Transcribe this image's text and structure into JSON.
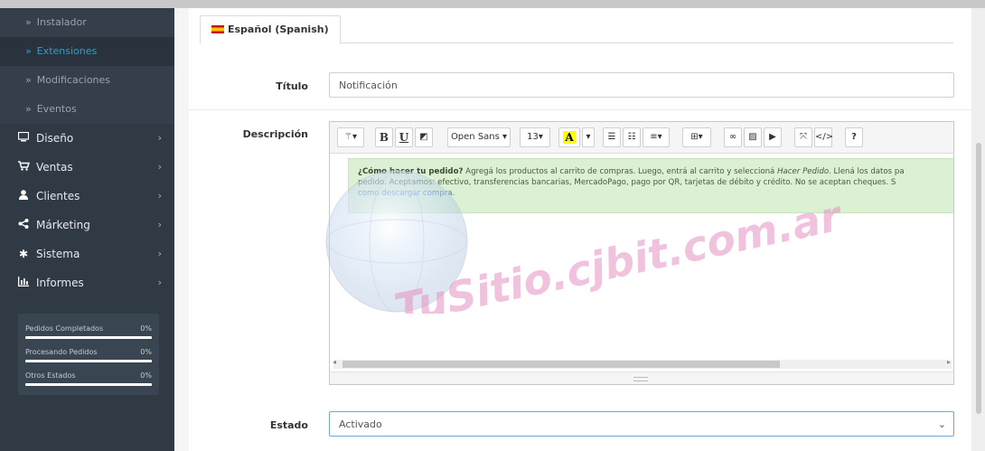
{
  "sidebar": {
    "subitems": [
      {
        "label": "Instalador",
        "active": false
      },
      {
        "label": "Extensiones",
        "active": true
      },
      {
        "label": "Modificaciones",
        "active": false
      },
      {
        "label": "Eventos",
        "active": false
      }
    ],
    "items": [
      {
        "label": "Diseño",
        "icon": "monitor-icon"
      },
      {
        "label": "Ventas",
        "icon": "cart-icon"
      },
      {
        "label": "Clientes",
        "icon": "user-icon"
      },
      {
        "label": "Márketing",
        "icon": "share-icon"
      },
      {
        "label": "Sistema",
        "icon": "gear-icon"
      },
      {
        "label": "Informes",
        "icon": "bar-chart-icon"
      }
    ],
    "stats": [
      {
        "label": "Pedidos Completados",
        "percent": "0%"
      },
      {
        "label": "Procesando Pedidos",
        "percent": "0%"
      },
      {
        "label": "Otros Estados",
        "percent": "0%"
      }
    ]
  },
  "form": {
    "language_tab": "Español (Spanish)",
    "title_label": "Título",
    "title_value": "Notificación",
    "description_label": "Descripción",
    "status_label": "Estado",
    "status_value": "Activado"
  },
  "editor": {
    "font_name": "Open Sans ▾",
    "font_size": "13▾",
    "toolbar_icons": [
      "magic-icon",
      "bold-icon",
      "underline-icon",
      "eraser-icon",
      "font-family-select",
      "font-size-select",
      "highlight-color-icon",
      "color-dropdown-icon",
      "unordered-list-icon",
      "ordered-list-icon",
      "align-icon",
      "table-icon",
      "link-icon",
      "image-icon",
      "video-icon",
      "fullscreen-icon",
      "code-view-icon",
      "help-icon"
    ],
    "content": {
      "question": "¿Cómo hacer tu pedido?",
      "line1": " Agregá los productos al carrito de compras. Luego, entrá al carrito y seleccioná ",
      "italic": "Hacer Pedido",
      "line1b": ". Llená los datos pa",
      "line2": "pedido. Aceptamos: efectivo, transferencias bancarias, MercadoPago, pago por QR, tarjetas de débito y crédito. No se aceptan cheques. S",
      "link": "como descargar compra."
    }
  },
  "watermark": {
    "text": "TuSitio.cjbit.com.ar"
  },
  "colors": {
    "sidebar_bg": "#303a45",
    "active_link": "#23a1d1",
    "note_bg": "#dcf0d3",
    "watermark_pink": "#e58fc1"
  }
}
